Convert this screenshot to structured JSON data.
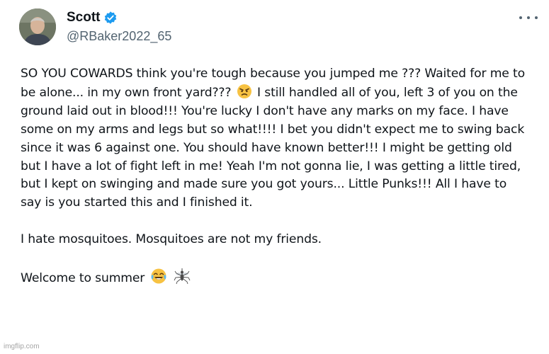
{
  "author": {
    "display_name": "Scott",
    "handle": "@RBaker2022_65",
    "avatar_icon": "profile-photo",
    "verified_icon": "verified-badge-icon",
    "verified_color": "#1d9bf0"
  },
  "more_menu_icon": "more-options-icon",
  "tweet": {
    "paragraph_1": {
      "part_1": "SO YOU COWARDS think you're tough because you jumped me ??? Waited for me to be alone... in my own front yard???",
      "emoji_1": "angry-face-emoji",
      "part_2": "I still handled all of you, left 3 of you on the ground laid out in blood!!! You're lucky I don't have any marks on my face. I have some on my arms and legs but so what!!!! I bet you didn't expect me to swing back since it was 6 against one. You should have known better!!! I might be getting old but I have a lot of fight left in me! Yeah I'm not gonna lie, I was getting a little tired, but I kept on swinging and made sure you got yours... Little Punks!!! All I have to say is you started this and I finished it."
    },
    "paragraph_2": "I hate mosquitoes. Mosquitoes are not my friends.",
    "paragraph_3": {
      "text": "Welcome to summer",
      "emoji_1": "face-with-tears-of-joy-emoji",
      "emoji_2": "mosquito-emoji"
    }
  },
  "watermark": "imgflip.com"
}
